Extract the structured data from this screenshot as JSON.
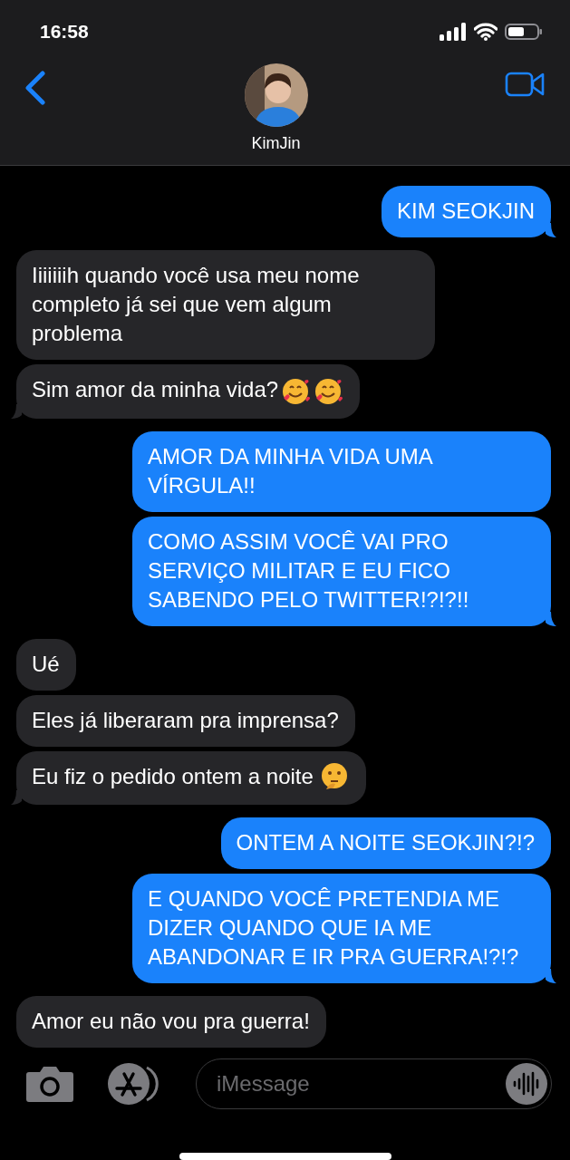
{
  "status_bar": {
    "time": "16:58"
  },
  "header": {
    "contact_name": "KimJin"
  },
  "messages": [
    {
      "kind": "sent",
      "text": "KIM SEOKJIN",
      "tail": true
    },
    {
      "kind": "received",
      "text": "Iiiiiiih quando você usa meu nome completo já sei que vem algum problema",
      "tail": false
    },
    {
      "kind": "received",
      "text": "Sim amor da minha vida?",
      "tail": true,
      "icons": [
        {
          "kind": "hearts-face"
        },
        {
          "kind": "hearts-face"
        }
      ]
    },
    {
      "kind": "sent",
      "text": "AMOR DA MINHA VIDA UMA VÍRGULA!!",
      "tail": false
    },
    {
      "kind": "sent",
      "text": "COMO ASSIM VOCÊ VAI PRO SERVIÇO MILITAR E EU FICO SABENDO PELO TWITTER!?!?!!",
      "tail": true
    },
    {
      "kind": "received",
      "text": "Ué",
      "tail": false
    },
    {
      "kind": "received",
      "text": "Eles já liberaram pra imprensa?",
      "tail": false
    },
    {
      "kind": "received",
      "text": "Eu fiz o pedido ontem a noite",
      "tail": true,
      "icons": [
        {
          "kind": "thinking-face"
        }
      ]
    },
    {
      "kind": "sent",
      "text": "ONTEM A NOITE SEOKJIN?!?",
      "tail": false
    },
    {
      "kind": "sent",
      "text": "E QUANDO VOCÊ PRETENDIA ME DIZER QUANDO QUE IA ME ABANDONAR E IR PRA GUERRA!?!?",
      "tail": true
    },
    {
      "kind": "received",
      "text": "Amor eu não vou pra guerra!",
      "tail": false
    }
  ],
  "composer": {
    "placeholder": "iMessage"
  }
}
